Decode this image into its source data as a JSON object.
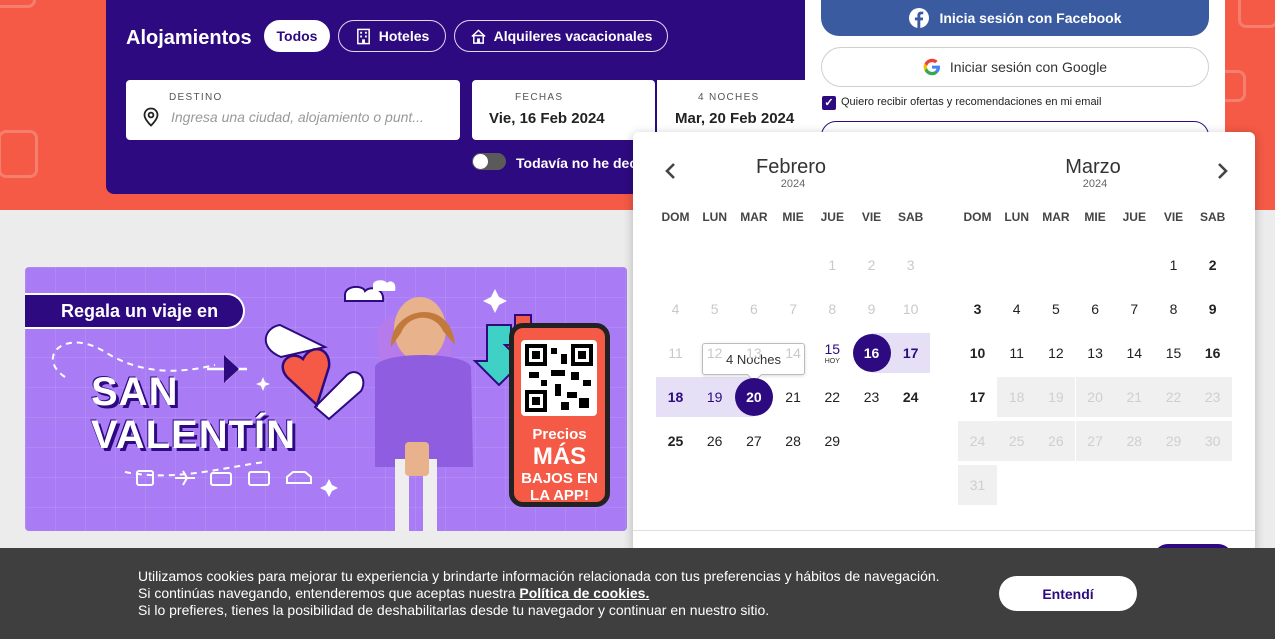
{
  "search": {
    "title": "Alojamientos",
    "tabs": [
      {
        "label": "Todos",
        "active": true,
        "icon": "none"
      },
      {
        "label": "Hoteles",
        "active": false,
        "icon": "building-icon"
      },
      {
        "label": "Alquileres vacacionales",
        "active": false,
        "icon": "house-icon"
      }
    ],
    "destino": {
      "label": "DESTINO",
      "placeholder": "Ingresa una ciudad, alojamiento o punt..."
    },
    "fechas": {
      "label": "FECHAS",
      "value": "Vie, 16 Feb 2024"
    },
    "noches": {
      "label": "4 NOCHES",
      "value": "Mar, 20 Feb 2024"
    },
    "toggle_label": "Todavía no he dec"
  },
  "login": {
    "facebook": "Inicia sesión con Facebook",
    "google": "Iniciar sesión con Google",
    "offers": "Quiero recibir ofertas y recomendaciones en mi email"
  },
  "banner": {
    "ribbon": "Regala un viaje en",
    "line1": "SAN",
    "line2": "VALENTÍN",
    "phone_line1": "Precios",
    "phone_line2": "MÁS",
    "phone_line3": "BAJOS EN",
    "phone_line4": "LA APP!"
  },
  "calendar": {
    "weekdays": [
      "DOM",
      "LUN",
      "MAR",
      "MIE",
      "JUE",
      "VIE",
      "SAB"
    ],
    "today_label": "HOY",
    "tooltip": "4 Noches",
    "months": [
      {
        "name": "Febrero",
        "year": "2024",
        "first_weekday": 4,
        "days": 29,
        "disabled_before": 15,
        "today": 15
      },
      {
        "name": "Marzo",
        "year": "2024",
        "first_weekday": 5,
        "days": 31,
        "blocked_from": 18
      }
    ],
    "range_start": "2024-02-16",
    "range_end": "2024-02-20",
    "colors": {
      "accent": "#2e0a80",
      "range": "#e6e0f7",
      "hero": "#f45a45"
    }
  },
  "cookies": {
    "line1": "Utilizamos cookies para mejorar tu experiencia y brindarte información relacionada con tus preferencias y hábitos de navegación.",
    "line2_pre": "Si continúas navegando, entenderemos que aceptas nuestra ",
    "line2_link": "Política de cookies.",
    "line3": "Si lo prefieres, tienes la posibilidad de deshabilitarlas desde tu navegador y continuar en nuestro sitio.",
    "accept": "Entendí"
  }
}
